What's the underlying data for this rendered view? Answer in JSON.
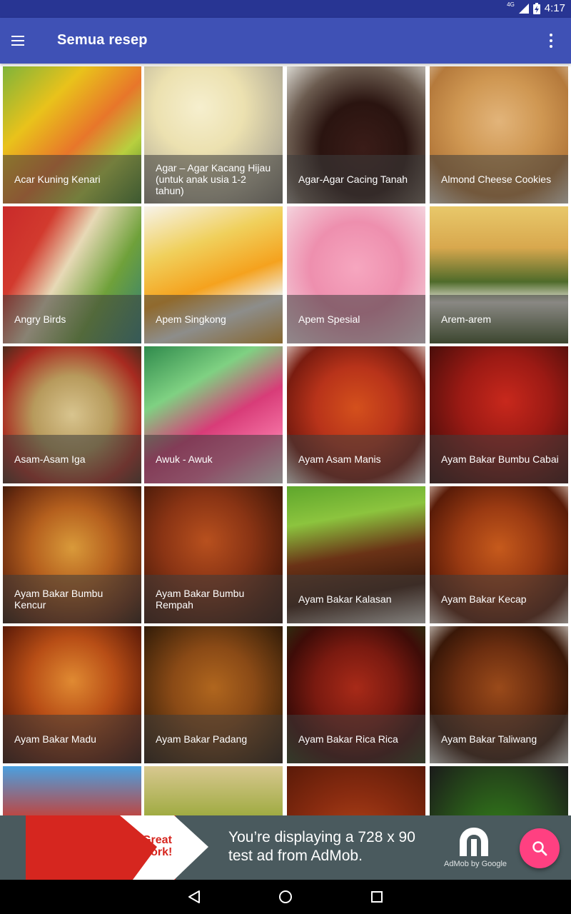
{
  "status_bar": {
    "network": "4G",
    "time": "4:17"
  },
  "app_bar": {
    "title": "Semua resep"
  },
  "recipes": [
    {
      "label": "Acar Kuning Kenari"
    },
    {
      "label": "Agar – Agar Kacang Hijau (untuk anak usia 1-2 tahun)"
    },
    {
      "label": "Agar-Agar Cacing Tanah"
    },
    {
      "label": "Almond Cheese Cookies"
    },
    {
      "label": "Angry Birds"
    },
    {
      "label": "Apem Singkong"
    },
    {
      "label": "Apem Spesial"
    },
    {
      "label": "Arem-arem"
    },
    {
      "label": "Asam-Asam Iga"
    },
    {
      "label": "Awuk - Awuk"
    },
    {
      "label": "Ayam Asam Manis"
    },
    {
      "label": "Ayam Bakar Bumbu Cabai"
    },
    {
      "label": "Ayam Bakar Bumbu Kencur"
    },
    {
      "label": "Ayam Bakar Bumbu Rempah"
    },
    {
      "label": "Ayam Bakar Kalasan"
    },
    {
      "label": "Ayam Bakar Kecap"
    },
    {
      "label": "Ayam Bakar Madu"
    },
    {
      "label": "Ayam Bakar Padang"
    },
    {
      "label": "Ayam Bakar Rica Rica"
    },
    {
      "label": "Ayam Bakar Taliwang"
    }
  ],
  "ad_banner": {
    "badge": "Great work!",
    "text": "You’re displaying a 728 x 90 test ad from AdMob.",
    "attribution": "AdMob by Google"
  },
  "colors": {
    "status_bar": "#283593",
    "app_bar": "#3f51b5",
    "fab": "#ff4081",
    "ad_background": "#4a5a5e",
    "ad_red": "#d6261f"
  },
  "icons": {
    "menu": "menu-icon",
    "overflow": "more-vert-icon",
    "fab": "search-icon",
    "nav_back": "back-icon",
    "nav_home": "home-icon",
    "nav_recents": "recents-icon"
  }
}
